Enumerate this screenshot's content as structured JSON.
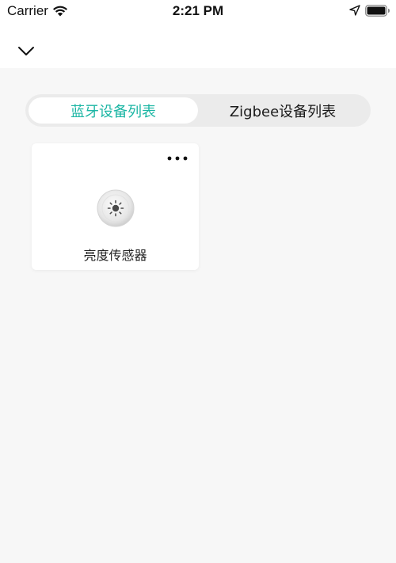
{
  "status_bar": {
    "carrier": "Carrier",
    "time": "2:21 PM",
    "icons": [
      "wifi-icon",
      "location-arrow-icon",
      "battery-icon"
    ]
  },
  "nav": {
    "back_icon": "chevron-down-icon"
  },
  "tabs": [
    {
      "label": "蓝牙设备列表",
      "active": true
    },
    {
      "label": "Zigbee设备列表",
      "active": false
    }
  ],
  "devices": [
    {
      "name": "亮度传感器",
      "icon": "light-sensor-icon",
      "menu_icon": "more-dots-icon"
    }
  ],
  "colors": {
    "accent": "#1cb6a4",
    "background": "#f7f7f7",
    "card": "#ffffff",
    "segment_bg": "#ebebeb"
  }
}
